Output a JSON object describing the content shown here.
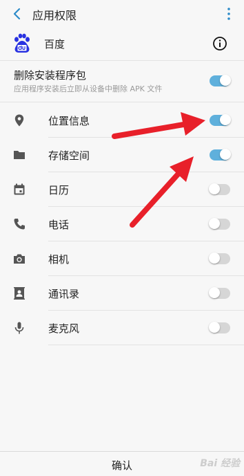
{
  "header": {
    "title": "应用权限"
  },
  "app": {
    "name": "百度"
  },
  "delete_package": {
    "title": "删除安装程序包",
    "subtitle": "应用程序安装后立即从设备中删除 APK 文件",
    "enabled": true
  },
  "permissions": [
    {
      "label": "位置信息",
      "icon": "location-icon",
      "enabled": true
    },
    {
      "label": "存储空间",
      "icon": "folder-icon",
      "enabled": true
    },
    {
      "label": "日历",
      "icon": "calendar-icon",
      "enabled": false
    },
    {
      "label": "电话",
      "icon": "phone-icon",
      "enabled": false
    },
    {
      "label": "相机",
      "icon": "camera-icon",
      "enabled": false
    },
    {
      "label": "通讯录",
      "icon": "contacts-icon",
      "enabled": false
    },
    {
      "label": "麦克风",
      "icon": "microphone-icon",
      "enabled": false
    }
  ],
  "footer": {
    "confirm_label": "确认",
    "watermark": "Bai 经验"
  },
  "colors": {
    "accent": "#2d8bc9",
    "toggle_on": "#5fb0dc",
    "toggle_off": "#d6d6d6",
    "arrow": "#e8202a"
  }
}
